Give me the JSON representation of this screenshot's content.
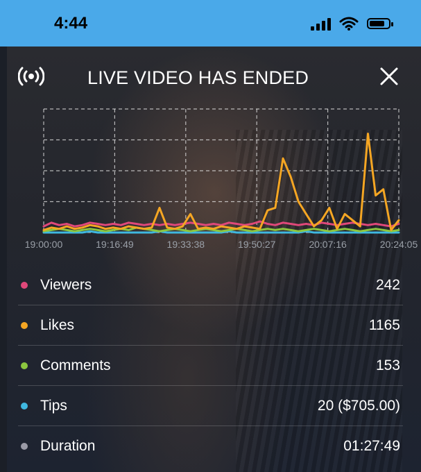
{
  "status_bar": {
    "time": "4:44"
  },
  "header": {
    "title": "LIVE VIDEO HAS ENDED"
  },
  "chart_data": {
    "type": "line",
    "x_tick_labels": [
      "19:00:00",
      "19:16:49",
      "19:33:38",
      "19:50:27",
      "20:07:16",
      "20:24:05"
    ],
    "ylim": [
      0,
      100
    ],
    "grid": true,
    "series": [
      {
        "name": "Viewers",
        "color": "#e0487a",
        "values": [
          5,
          8,
          6,
          7,
          5,
          6,
          8,
          7,
          6,
          7,
          6,
          8,
          7,
          6,
          7,
          6,
          7,
          6,
          7,
          8,
          7,
          6,
          7,
          6,
          8,
          7,
          6,
          7,
          9,
          7,
          6,
          8,
          7,
          6,
          7,
          6,
          8,
          7,
          6,
          7,
          8,
          7,
          6,
          7,
          6,
          5,
          7
        ]
      },
      {
        "name": "Likes",
        "color": "#f5a623",
        "values": [
          2,
          4,
          3,
          5,
          3,
          4,
          6,
          5,
          3,
          4,
          3,
          5,
          4,
          3,
          4,
          20,
          4,
          3,
          5,
          15,
          3,
          4,
          3,
          5,
          4,
          3,
          5,
          4,
          3,
          18,
          20,
          60,
          45,
          25,
          15,
          5,
          10,
          20,
          3,
          15,
          10,
          5,
          80,
          30,
          35,
          2,
          10
        ]
      },
      {
        "name": "Comments",
        "color": "#8cc63f",
        "values": [
          1,
          2,
          3,
          2,
          1,
          2,
          3,
          2,
          1,
          2,
          3,
          2,
          4,
          3,
          2,
          1,
          2,
          3,
          2,
          1,
          2,
          3,
          2,
          1,
          2,
          3,
          2,
          1,
          2,
          3,
          2,
          3,
          2,
          1,
          2,
          3,
          2,
          1,
          2,
          3,
          2,
          1,
          2,
          3,
          2,
          1,
          2
        ]
      },
      {
        "name": "Tips",
        "color": "#3fb8e0",
        "values": [
          0,
          0,
          0,
          0,
          0,
          0,
          1,
          0,
          0,
          0,
          0,
          0,
          0,
          0,
          0,
          1,
          0,
          0,
          0,
          0,
          0,
          0,
          0,
          0,
          1,
          0,
          0,
          0,
          0,
          0,
          0,
          0,
          0,
          0,
          1,
          0,
          0,
          0,
          0,
          0,
          0,
          0,
          0,
          0,
          0,
          0,
          0
        ]
      }
    ]
  },
  "stats": [
    {
      "label": "Viewers",
      "value": "242",
      "color": "#e0487a"
    },
    {
      "label": "Likes",
      "value": "1165",
      "color": "#f5a623"
    },
    {
      "label": "Comments",
      "value": "153",
      "color": "#8cc63f"
    },
    {
      "label": "Tips",
      "value": "20 ($705.00)",
      "color": "#3fb8e0"
    },
    {
      "label": "Duration",
      "value": "01:27:49",
      "color": "#9a9aa6"
    }
  ]
}
